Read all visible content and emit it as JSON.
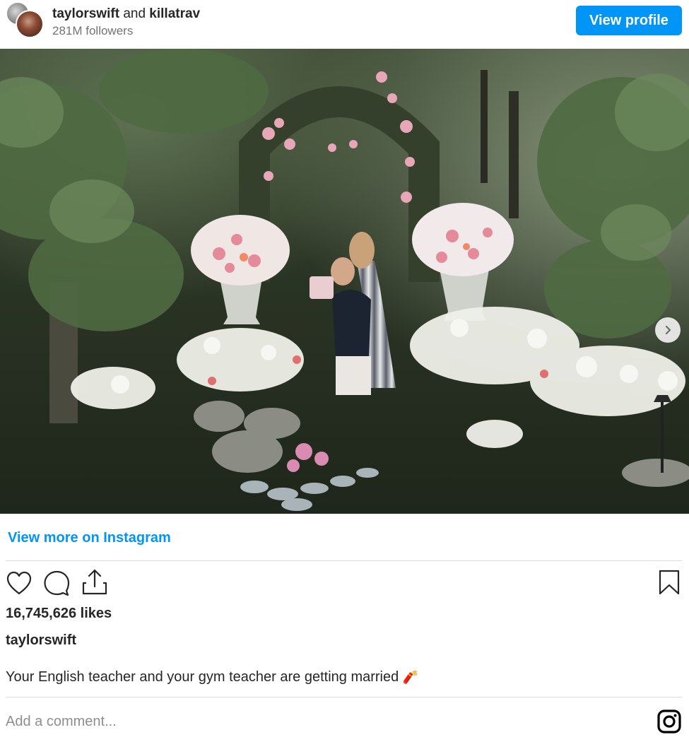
{
  "header": {
    "user1": "taylorswift",
    "conjunction": "and",
    "user2": "killatrav",
    "followers": "281M followers",
    "view_profile_label": "View profile"
  },
  "post": {
    "carousel": {
      "total": 4,
      "active_index": 0
    },
    "view_more_label": "View more on Instagram",
    "likes": "16,745,626 likes",
    "caption_user": "taylorswift",
    "caption_text": "Your English teacher and your gym teacher are getting married",
    "caption_emoji": "🧨"
  },
  "comment": {
    "placeholder": "Add a comment..."
  },
  "icons": {
    "like": "heart-icon",
    "comment": "comment-icon",
    "share": "share-icon",
    "save": "bookmark-icon",
    "next": "chevron-right-icon",
    "instagram": "instagram-icon"
  },
  "colors": {
    "accent": "#0095f6",
    "text": "#262626",
    "muted": "#737373",
    "divider": "#dbdbdb"
  }
}
